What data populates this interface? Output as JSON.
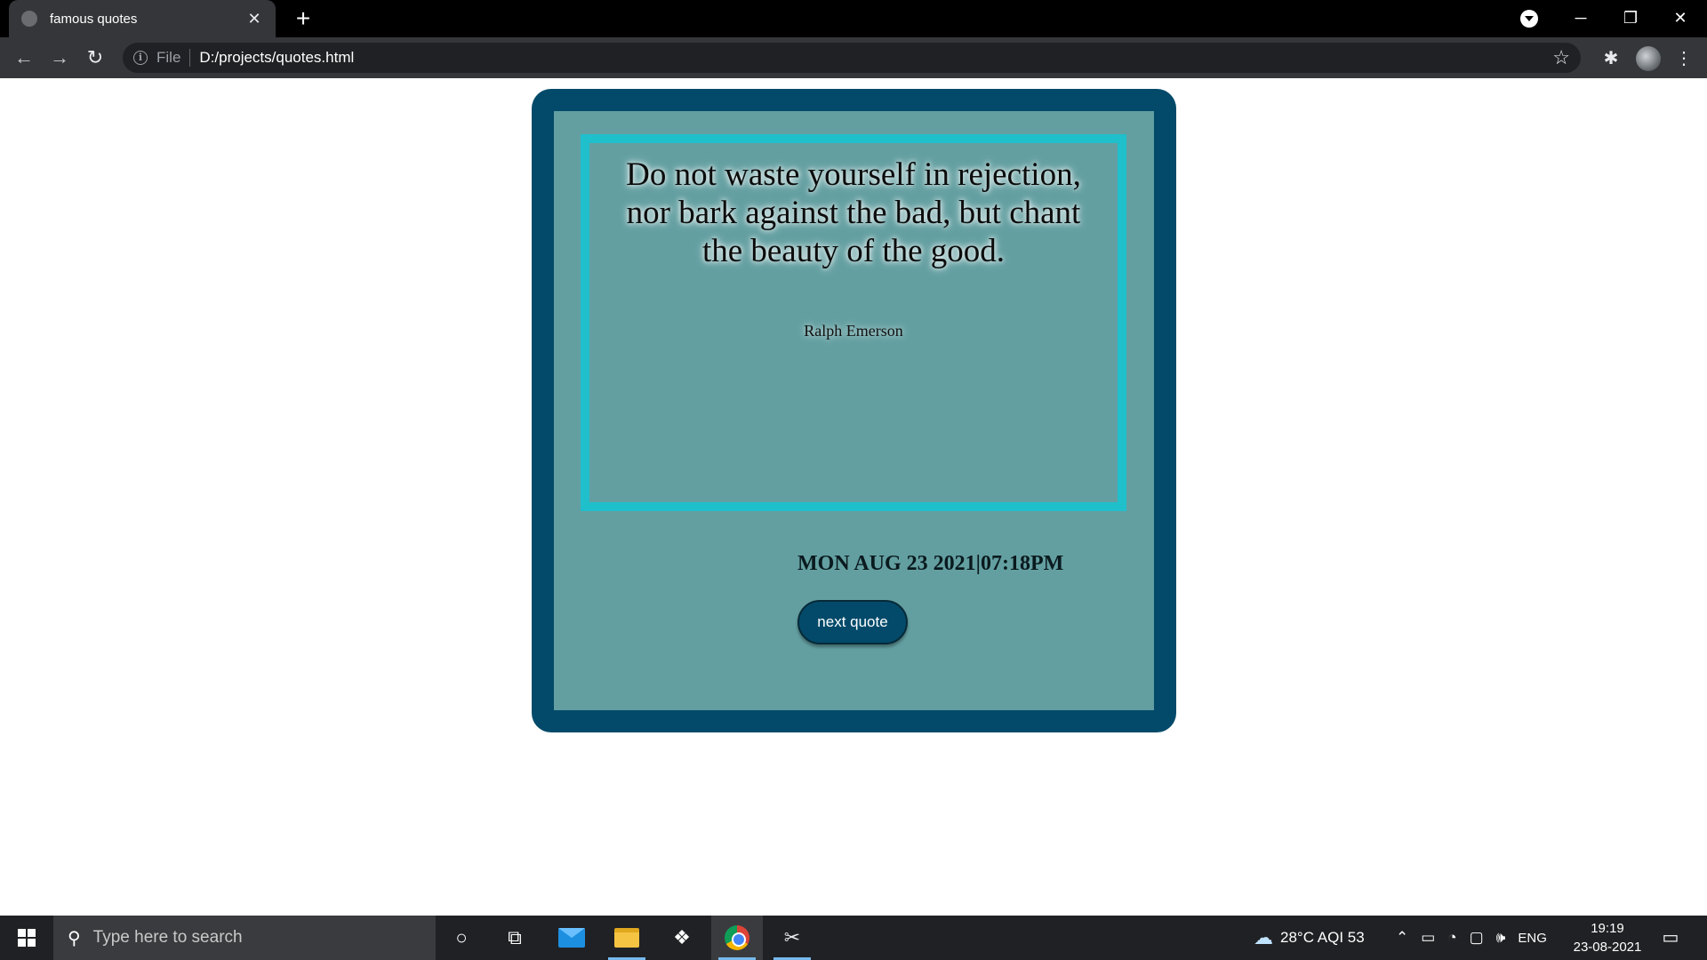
{
  "browser": {
    "tab_title": "famous quotes",
    "tab_close": "✕",
    "new_tab": "+",
    "url_scheme": "File",
    "url": "D:/projects/quotes.html",
    "window_controls": {
      "minimize": "─",
      "restore": "❐",
      "close": "✕"
    }
  },
  "quote": {
    "text": "Do not waste yourself in rejection, nor bark against the bad, but chant the beauty of the good.",
    "author": "Ralph Emerson"
  },
  "datetime": "MON AUG 23 2021|07:18PM",
  "next_button_label": "next quote",
  "taskbar": {
    "search_placeholder": "Type here to search",
    "weather": "28°C  AQI 53",
    "language": "ENG",
    "time": "19:19",
    "date": "23-08-2021"
  },
  "colors": {
    "outer_card": "#034a6a",
    "inner_card": "#639fa1",
    "quote_border": "#1fbfcb",
    "button_bg": "#034a6a"
  }
}
